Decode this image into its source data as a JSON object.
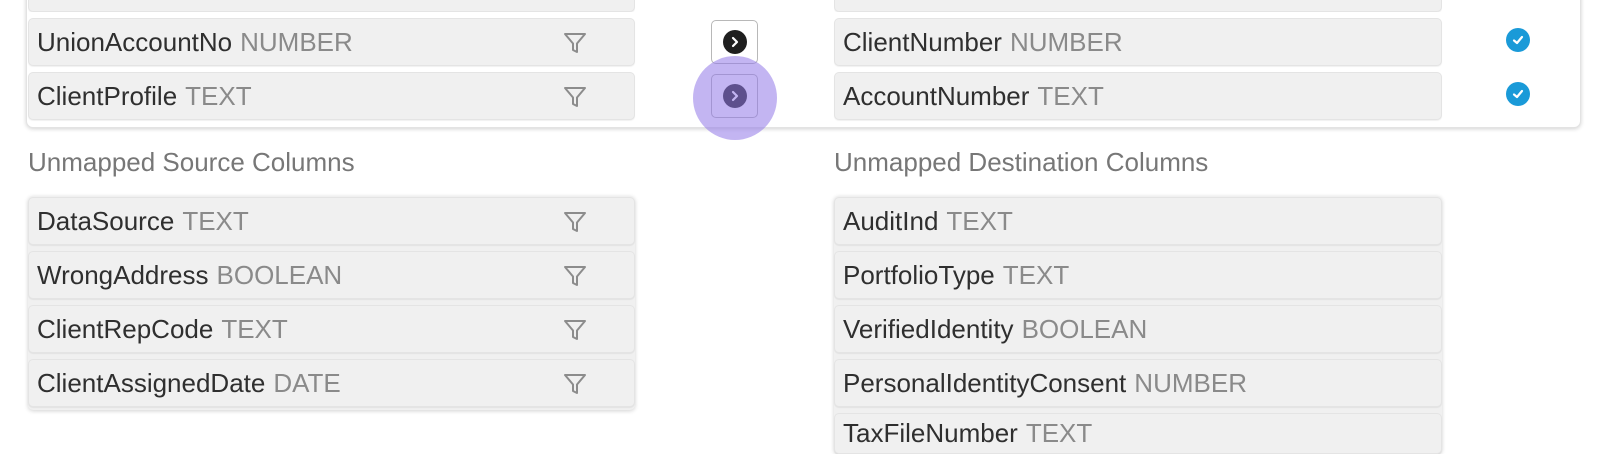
{
  "mapped": {
    "source_rows": [
      {
        "name": "UnionAccountNo",
        "type": "NUMBER"
      },
      {
        "name": "ClientProfile",
        "type": "TEXT"
      }
    ],
    "destination_rows": [
      {
        "name": "ClientNumber",
        "type": "NUMBER"
      },
      {
        "name": "AccountNumber",
        "type": "TEXT"
      }
    ]
  },
  "unmapped_source": {
    "title": "Unmapped Source Columns",
    "rows": [
      {
        "name": "DataSource",
        "type": "TEXT"
      },
      {
        "name": "WrongAddress",
        "type": "BOOLEAN"
      },
      {
        "name": "ClientRepCode",
        "type": "TEXT"
      },
      {
        "name": "ClientAssignedDate",
        "type": "DATE"
      }
    ]
  },
  "unmapped_destination": {
    "title": "Unmapped Destination Columns",
    "rows": [
      {
        "name": "AuditInd",
        "type": "TEXT"
      },
      {
        "name": "PortfolioType",
        "type": "TEXT"
      },
      {
        "name": "VerifiedIdentity",
        "type": "BOOLEAN"
      },
      {
        "name": "PersonalIdentityConsent",
        "type": "NUMBER"
      },
      {
        "name": "TaxFileNumber",
        "type": "TEXT"
      }
    ]
  },
  "icons": {
    "filter": "filter-icon",
    "map_arrow": "chevron-right-circle-icon",
    "mapped_check": "check-circle-icon"
  },
  "colors": {
    "check": "#1a9ad8",
    "click_highlight": "#9278e8",
    "row_background": "#f0f0f0",
    "type_text": "#8a8a8a"
  }
}
